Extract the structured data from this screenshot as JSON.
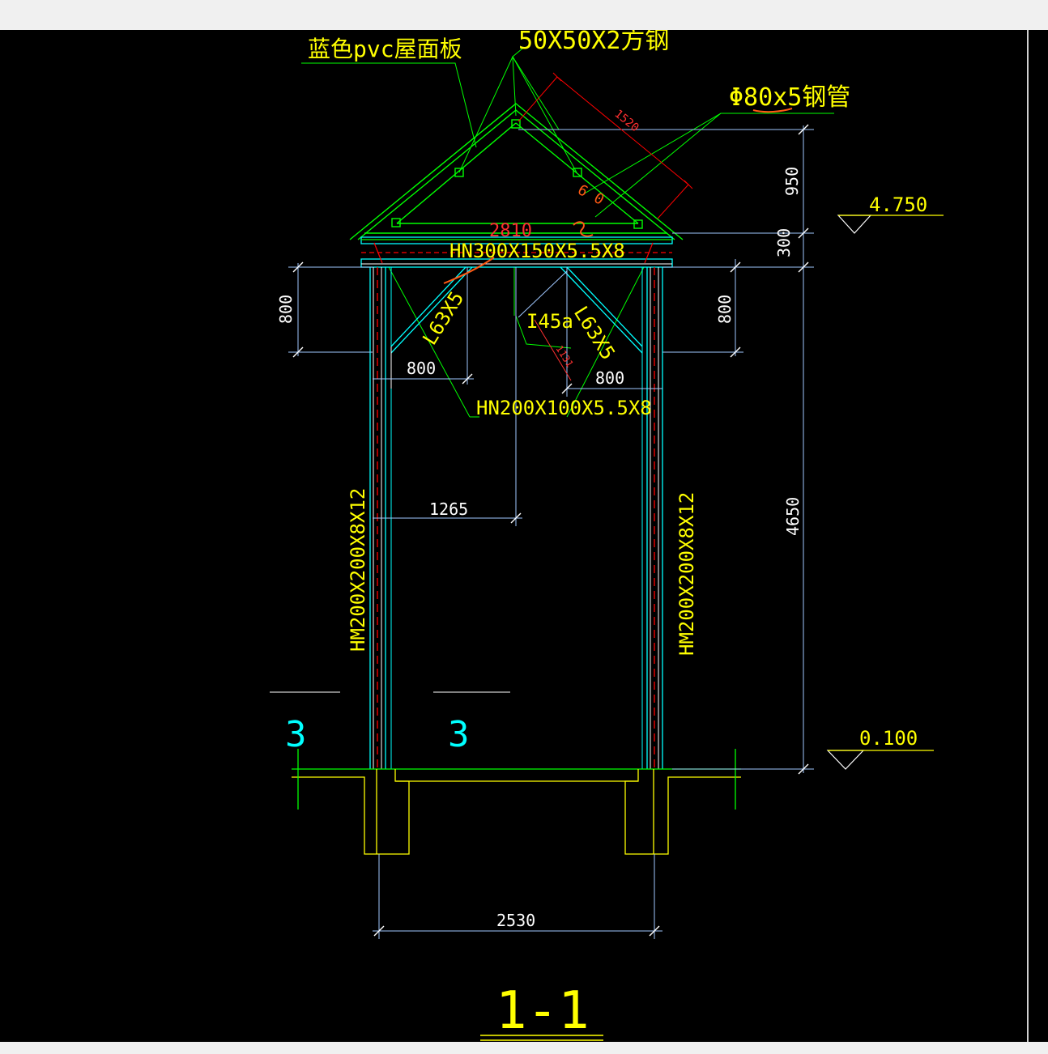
{
  "drawing": {
    "title": "1-1",
    "labels": {
      "roof_panel": "蓝色pvc屋面板",
      "square_tube": "50X50X2方钢",
      "steel_pipe": "Φ80x5钢管",
      "top_beam": "HN300X150X5.5X8",
      "brace_beam": "HN200X100X5.5X8",
      "angle_left": "L63X5",
      "angle_right": "L63X5",
      "channel": "I45a",
      "column_left": "HM200X200X8X12",
      "column_right": "HM200X200X8X12",
      "section_mark_left": "3",
      "section_mark_right": "3"
    },
    "dims": {
      "rafter": "1520",
      "span_top": "2810",
      "roof_height": "950",
      "beam_depth": "300",
      "brace_left_v": "800",
      "brace_right_v": "800",
      "brace_left_h": "800",
      "brace_right_h": "800",
      "diag": "1131",
      "half_span": "1265",
      "column_height": "4650",
      "base_width": "2530"
    },
    "elevations": {
      "top": "4.750",
      "bottom": "0.100"
    },
    "annotations": {
      "mark1": "6",
      "mark2": "0"
    }
  },
  "colors": {
    "green": "#00ff00",
    "yellow": "#ffff00",
    "white": "#ffffff",
    "cyan": "#00ffff",
    "red": "#ff0000",
    "orange": "#ff5a14",
    "blueish": "#a0c8ff"
  }
}
